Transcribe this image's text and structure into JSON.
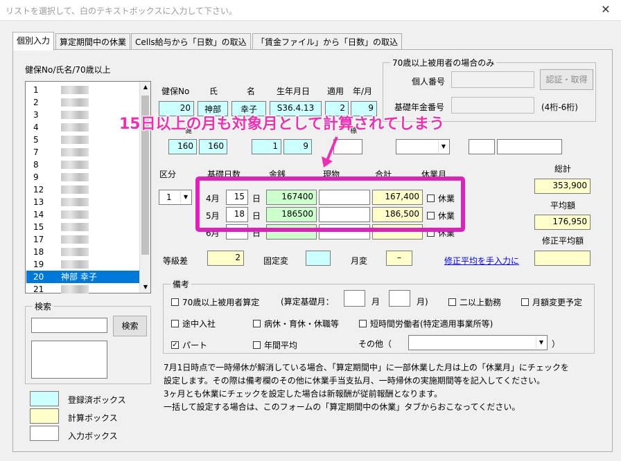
{
  "window": {
    "title": "リストを選択して、白のテキストボックスに入力して下さい。"
  },
  "icons": {
    "close": "close-icon",
    "checked": "✓"
  },
  "tabs": [
    {
      "label": "個別入力"
    },
    {
      "label": "算定期間中の休業"
    },
    {
      "label": "Cells給与から「日数」の取込"
    },
    {
      "label": "「賃金ファイル」から「日数」の取込"
    }
  ],
  "list": {
    "header": "健保No/氏名/70歳以上",
    "rows": [
      {
        "no": "1",
        "name": ""
      },
      {
        "no": "2",
        "name": ""
      },
      {
        "no": "3",
        "name": ""
      },
      {
        "no": "4",
        "name": ""
      },
      {
        "no": "5",
        "name": ""
      },
      {
        "no": "7",
        "name": ""
      },
      {
        "no": "8",
        "name": ""
      },
      {
        "no": "9",
        "name": ""
      },
      {
        "no": "12",
        "name": ""
      },
      {
        "no": "13",
        "name": ""
      },
      {
        "no": "14",
        "name": ""
      },
      {
        "no": "15",
        "name": ""
      },
      {
        "no": "17",
        "name": ""
      },
      {
        "no": "18",
        "name": ""
      },
      {
        "no": "19",
        "name": ""
      },
      {
        "no": "20",
        "name": "神部 幸子"
      },
      {
        "no": "21",
        "name": ""
      }
    ],
    "selected_index": 15
  },
  "search": {
    "title": "検索",
    "button": "検索",
    "value": ""
  },
  "legend": [
    {
      "label": "登録済ボックス",
      "color": "#ccffff"
    },
    {
      "label": "計算ボックス",
      "color": "#ffffcc"
    },
    {
      "label": "入力ボックス",
      "color": "#ffffff"
    }
  ],
  "employee": {
    "headers": {
      "no": "健保No",
      "last": "氏",
      "first": "名",
      "birth": "生年月日",
      "apply": "適用",
      "ym": "年/月"
    },
    "values": {
      "no": "20",
      "last": "神部",
      "first": "幸子",
      "birth": "S36.4.13",
      "apply": "2",
      "ym": "9"
    },
    "row2_partial": [
      "健",
      "標"
    ],
    "row2": [
      "160",
      "160",
      "1",
      "9"
    ]
  },
  "over70": {
    "title": "70歳以上被用者の場合のみ",
    "personal_no": "個人番号",
    "pension_no": "基礎年金番号",
    "auth_button": "認証・取得",
    "digits_note": "(4桁-6桁)"
  },
  "callout": "15日以上の月も対象月として計算されてしまう",
  "table": {
    "kubun_label": "区分",
    "kubun_value": "1",
    "headers": {
      "days": "基礎日数",
      "money": "金銭",
      "goods": "現物",
      "total": "合計",
      "leave": "休業月"
    },
    "day_unit": "日",
    "leave_label": "休業",
    "rows": [
      {
        "month": "4月",
        "days": "15",
        "money": "167400",
        "goods": "",
        "total": "167,400"
      },
      {
        "month": "5月",
        "days": "18",
        "money": "186500",
        "goods": "",
        "total": "186,500"
      },
      {
        "month": "6月",
        "days": "",
        "money": "",
        "goods": "",
        "total": ""
      }
    ]
  },
  "totals": {
    "sum_label": "総計",
    "sum": "353,900",
    "avg_label": "平均額",
    "avg": "176,950",
    "corr_label": "修正平均額",
    "corr": ""
  },
  "grade": {
    "diff_label": "等級差",
    "diff": "2",
    "fixed_label": "固定変",
    "fixed": "",
    "change_label": "月変",
    "change": "–",
    "link": "修正平均を手入力に"
  },
  "remarks": {
    "title": "備考",
    "over70": "70歳以上被用者算定",
    "base_month_label": "(算定基礎月：",
    "month_unit": "月",
    "close_paren": "月)",
    "multi": "二以上勤務",
    "monthly_change": "月額変更予定",
    "midjoin": "途中入社",
    "leave": "病休・育休・休職等",
    "short": "短時間労働者(特定適用事業所等)",
    "part": "パート",
    "annual": "年間平均",
    "other_label": "その他（",
    "other_close": "）"
  },
  "notes": [
    "7月1日時点で一時帰休が解消している場合、「算定期間中」に一部休業した月は上の「休業月」にチェックを",
    "設定します。その際は備考欄のその他に休業手当支払月、一時帰休の実施期間等を記入してください。",
    "3ヶ月とも休業にチェックを設定した場合は新報酬が従前報酬となります。",
    "一括して設定する場合は、このフォームの「算定期間中の休業」タブからおこなってください。"
  ]
}
